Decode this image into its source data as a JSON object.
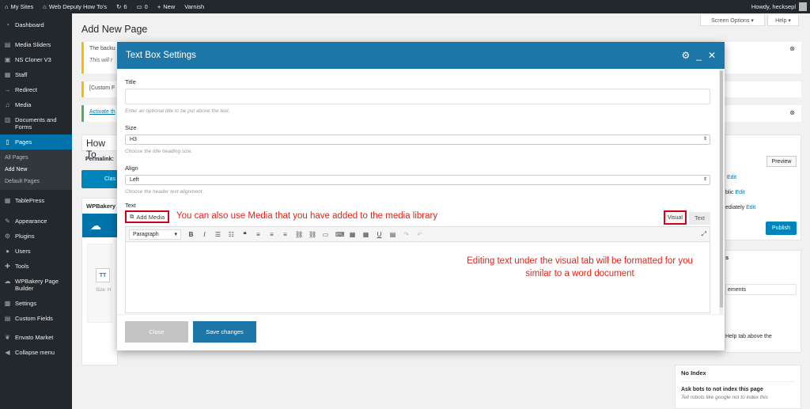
{
  "adminbar": {
    "my_sites": "My Sites",
    "site_name": "Web Deputy How To's",
    "updates_count": "6",
    "comments_count": "0",
    "new_label": "New",
    "varnish": "Varnish",
    "howdy": "Howdy, hecksepl"
  },
  "sidebar": {
    "items": [
      {
        "label": "Dashboard",
        "icon": "dashboard-icon"
      },
      {
        "label": "Media Sliders",
        "icon": "slider-icon"
      },
      {
        "label": "NS Cloner V3",
        "icon": "clone-icon"
      },
      {
        "label": "Staff",
        "icon": "staff-icon"
      },
      {
        "label": "Redirect",
        "icon": "redirect-icon"
      },
      {
        "label": "Media",
        "icon": "media-icon"
      },
      {
        "label": "Documents and Forms",
        "icon": "documents-icon"
      },
      {
        "label": "Pages",
        "icon": "pages-icon"
      },
      {
        "label": "TablePress",
        "icon": "table-icon"
      },
      {
        "label": "Appearance",
        "icon": "appearance-icon"
      },
      {
        "label": "Plugins",
        "icon": "plugins-icon"
      },
      {
        "label": "Users",
        "icon": "users-icon"
      },
      {
        "label": "Tools",
        "icon": "tools-icon"
      },
      {
        "label": "WPBakery Page Builder",
        "icon": "builder-icon"
      },
      {
        "label": "Settings",
        "icon": "settings-icon"
      },
      {
        "label": "Custom Fields",
        "icon": "fields-icon"
      },
      {
        "label": "Envato Market",
        "icon": "envato-icon"
      },
      {
        "label": "Collapse menu",
        "icon": "collapse-icon"
      }
    ],
    "pages_submenu": [
      "All Pages",
      "Add New",
      "Default Pages"
    ]
  },
  "header": {
    "screen_options": "Screen Options ▾",
    "help": "Help ▾",
    "page_title": "Add New Page"
  },
  "background": {
    "notice1": "The backu",
    "notice1b": "This will r",
    "notice2": "[Custom F",
    "notice3": "Activate th",
    "title_field": "How To",
    "permalink": "Permalink:",
    "classic_btn": "Clas",
    "wpbakery": "WPBakery",
    "size_hint": "Size: H",
    "preview": "Preview",
    "edit1": "Edit",
    "public": "blic",
    "edit2": "Edit",
    "immediately": "ediately",
    "edit3": "Edit",
    "publish": "Publish",
    "s_label": "s",
    "elements": "ements",
    "help_tab": "Help tab above the",
    "no_index_title": "No Index",
    "ask_bots": "Ask bots to not index this page",
    "tell_robots": "Tell robots like google not to index this"
  },
  "modal": {
    "title": "Text Box Settings",
    "fields": {
      "title_label": "Title",
      "title_value": "",
      "title_help": "Enter an optional title to be put above the text.",
      "size_label": "Size",
      "size_value": "H3",
      "size_help": "Choose the title heading size.",
      "align_label": "Align",
      "align_value": "Left",
      "align_help": "Choose the header text alignment.",
      "text_label": "Text"
    },
    "editor": {
      "add_media": "Add Media",
      "annotation_media": "You can also use Media that you have added to the media library",
      "tab_visual": "Visual",
      "tab_text": "Text",
      "paragraph": "Paragraph",
      "annotation_visual": "Editing text under the visual tab will be formatted for you similar to a word document"
    },
    "close_label": "Close",
    "save_label": "Save changes"
  },
  "colors": {
    "admin_dark": "#23282d",
    "accent_blue": "#0073aa",
    "modal_header": "#1d76a8",
    "annotation_red": "#e2231a"
  }
}
